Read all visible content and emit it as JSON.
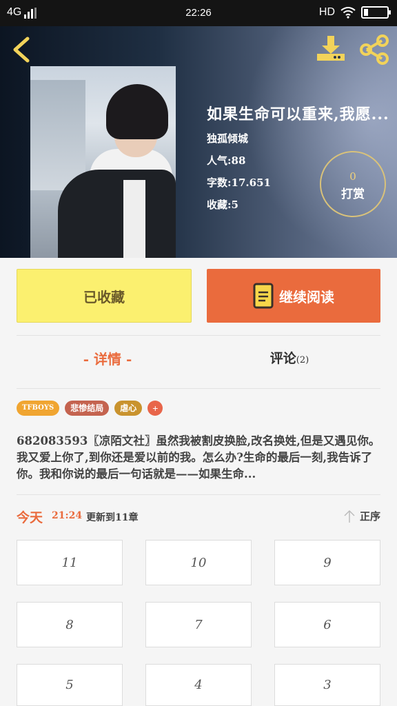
{
  "status_bar": {
    "network": "4G",
    "time": "22:26",
    "hd": "HD"
  },
  "header": {
    "back_icon": "chevron-left-icon",
    "download_icon": "download-icon",
    "share_icon": "share-icon"
  },
  "book": {
    "title": "如果生命可以重来,我愿...",
    "author": "独孤倾城",
    "popularity": "人气:88",
    "word_count": "字数:17.651",
    "favorites": "收藏:5",
    "reward_count": "0",
    "reward_label": "打赏"
  },
  "actions": {
    "collect_label": "已收藏",
    "read_label": "继续阅读"
  },
  "tabs": {
    "detail": "- 详情 -",
    "comment": "评论",
    "comment_count": "(2)"
  },
  "tags": [
    {
      "label": "TFBOYS",
      "color": "#f0a531"
    },
    {
      "label": "悲惨结局",
      "color": "#c4634f"
    },
    {
      "label": "虐心",
      "color": "#c9932e"
    }
  ],
  "tag_add": "+",
  "description": "682083593〖凉陌文社〗虽然我被割皮换脸,改名换姓,但是又遇见你。我又爱上你了,到你还是爱以前的我。怎么办?生命的最后一刻,我告诉了你。我和你说的最后一句话就是——如果生命...",
  "update": {
    "day": "今天",
    "time": "21:24",
    "text": "更新到11章",
    "sort_label": "正序"
  },
  "chapters": [
    "11",
    "10",
    "9",
    "8",
    "7",
    "6",
    "5",
    "4",
    "3"
  ],
  "colors": {
    "accent": "#ea6b3d",
    "collect_bg": "#fbf06f",
    "reward_ring": "#d9c27a"
  }
}
